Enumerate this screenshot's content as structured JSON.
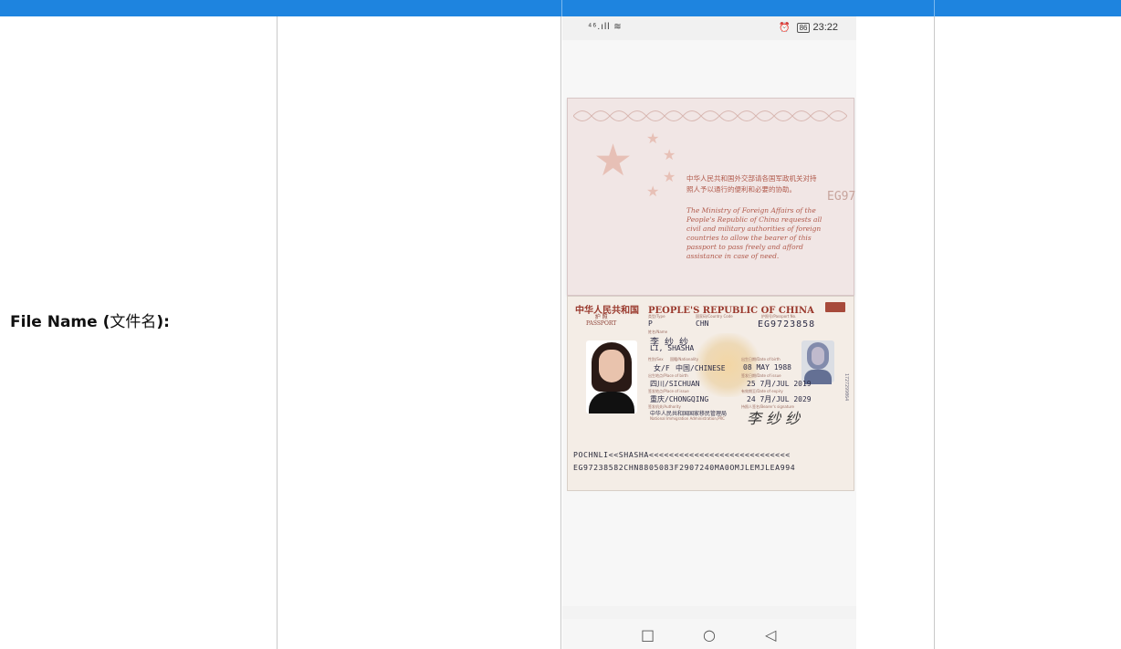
{
  "form": {
    "label_prefix": "File Name (",
    "label_cjk": "文件名",
    "label_suffix": "):"
  },
  "phone": {
    "status_left": "⁴⁶.ıll ≋",
    "alarm_icon": "alarm-icon",
    "battery": "86",
    "time": "23:22",
    "nav": {
      "recent": "□",
      "home": "○",
      "back": "◁"
    }
  },
  "passport": {
    "vertical_number": "EG9723858",
    "cn_text": "中华人民共和国外交部请各国军政机关对持照人予以通行的便利和必要的协助。",
    "en_text": "The Ministry of Foreign Affairs of the People's Republic of China requests all civil and military authorities of foreign countries to allow the bearer of this passport to pass freely and afford assistance in case of need.",
    "header_cn": "中华人民共和国",
    "header_en": "PEOPLE'S REPUBLIC OF CHINA",
    "sub_cn": "护  照",
    "sub_en": "PASSPORT",
    "type_label": "类型/Type",
    "type": "P",
    "country_label": "国家码/Country Code",
    "country": "CHN",
    "number_label": "护照号/Passport No.",
    "number": "EG9723858",
    "name_label": "姓名/Name",
    "name_cn": "李 纱 纱",
    "name_en": "LI, SHASHA",
    "sex_label": "性别/Sex",
    "nationality_label": "国籍/Nationality",
    "sex": "女/F",
    "nationality": "中国/CHINESE",
    "dob_label": "出生日期/Date of birth",
    "dob": "08 MAY 1988",
    "pob_label": "出生地点/Place of birth",
    "pob": "四川/SICHUAN",
    "doi_label": "签发日期/Date of issue",
    "doi": "25 7月/JUL 2019",
    "poi_label": "签发地点/Place of issue",
    "poi": "重庆/CHONGQING",
    "doe_label": "有效期至/Date of expiry",
    "doe": "24 7月/JUL 2029",
    "authority_label": "签发机关/Authority",
    "authority_cn": "中华人民共和国国家移民管理局",
    "authority_en": "National Immigration Administration,PRC",
    "signature_label": "持照人签名/Bearer's signature",
    "signature": "李 纱 纱",
    "side_number": "1727299064",
    "mrz1": "POCHNLI<<SHASHA<<<<<<<<<<<<<<<<<<<<<<<<<<<<",
    "mrz2": "EG97238582CHN8805083F2907240MA0OMJLEMJLEA994"
  }
}
